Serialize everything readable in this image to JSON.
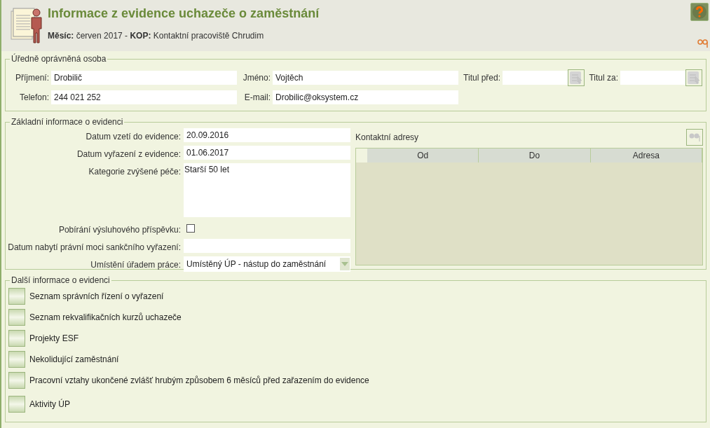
{
  "header": {
    "title": "Informace z evidence uchazeče o zaměstnání",
    "subtitle": "**Měsíc:** červen 2017 - **KOP:** Kontaktní pracoviště Chrudim"
  },
  "person": {
    "legend": "Úředně oprávněná osoba",
    "fields": [
      {
        "label": "Příjmení:",
        "value": "Drobilič"
      },
      {
        "label": "Jméno:",
        "value": "Vojtěch"
      },
      {
        "label": "Titul před:"
      },
      {
        "label": "Titul za:"
      },
      {
        "label": "Telefon:",
        "value": "244 021 252"
      },
      {
        "label": "E-mail:",
        "value": "Drobilic@oksystem.cz"
      }
    ]
  },
  "basic": {
    "legend": "Základní informace o evidenci",
    "rows": [
      {
        "kind": "text",
        "label": "Datum vzetí do evidence:",
        "value": "20.09.2016"
      },
      {
        "kind": "text",
        "label": "Datum vyřazení z evidence:",
        "value": "01.06.2017"
      },
      {
        "kind": "textarea",
        "label": "Kategorie zvýšené péče:",
        "value": "Starší 50 let"
      },
      {
        "kind": "checkbox",
        "label": "Pobírání výsluhového příspěvku:",
        "checked": false
      },
      {
        "kind": "text",
        "label": "Datum nabytí právní moci sankčního vyřazení:"
      },
      {
        "kind": "select",
        "label": "Umístění úřadem práce:",
        "value": "Umístěný ÚP - nástup do zaměstnání"
      }
    ],
    "addresses": {
      "title": "Kontaktní adresy",
      "columns": [
        "Od",
        "Do",
        "Adresa"
      ]
    }
  },
  "more": {
    "legend": "Další informace o evidenci",
    "items": [
      {
        "label": "Seznam správních řízení o vyřazení"
      },
      {
        "label": "Seznam rekvalifikačních kurzů uchazeče"
      },
      {
        "label": "Projekty ESF"
      },
      {
        "label": "Nekolidující zaměstnání"
      },
      {
        "label": "Pracovní vztahy ukončené zvlášť hrubým způsobem 6 měsíců před zařazením do evidence"
      },
      {
        "label": "Aktivity ÚP"
      }
    ]
  }
}
